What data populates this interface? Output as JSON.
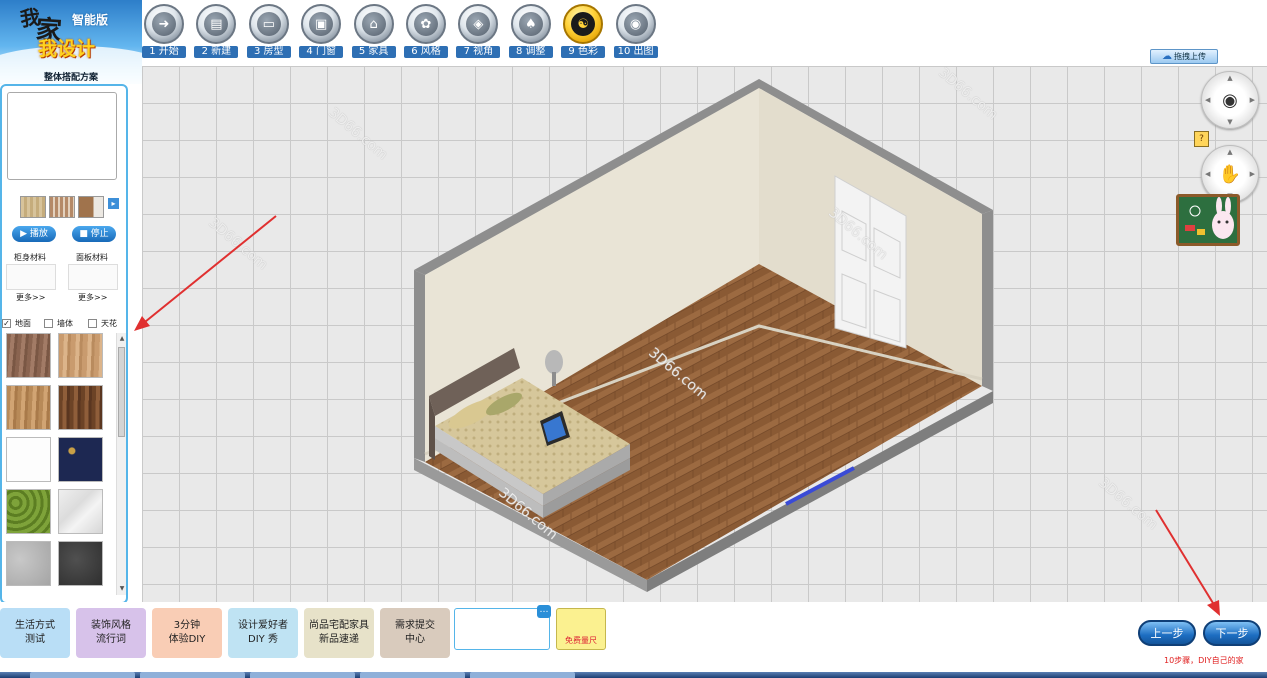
{
  "logo": {
    "line1": "我",
    "line2": "家",
    "subtitle": "我设计",
    "version": "智能版"
  },
  "sidebar": {
    "title": "整体搭配方案",
    "play_label": "▶ 播放",
    "stop_label": "■ 停止",
    "cabinet_label": "柜身材料",
    "panel_label": "面板材料",
    "more_left": "更多>>",
    "more_right": "更多>>",
    "surface_tabs": [
      {
        "label": "地面",
        "checked": true
      },
      {
        "label": "墙体",
        "checked": false
      },
      {
        "label": "天花",
        "checked": false
      }
    ]
  },
  "steps": [
    {
      "label": "1 开始",
      "icon": "arrow-right-icon",
      "glyph": "➜"
    },
    {
      "label": "2 新建",
      "icon": "new-file-icon",
      "glyph": "▤"
    },
    {
      "label": "3 房型",
      "icon": "floorplan-icon",
      "glyph": "▭"
    },
    {
      "label": "4 门窗",
      "icon": "window-icon",
      "glyph": "▣"
    },
    {
      "label": "5 家具",
      "icon": "furniture-icon",
      "glyph": "⌂"
    },
    {
      "label": "6 风格",
      "icon": "style-icon",
      "glyph": "✿"
    },
    {
      "label": "7 视角",
      "icon": "cube-icon",
      "glyph": "◈"
    },
    {
      "label": "8 调整",
      "icon": "lamp-icon",
      "glyph": "♠"
    },
    {
      "label": "9 色彩",
      "icon": "palette-icon",
      "glyph": "☯",
      "active": true
    },
    {
      "label": "10 出图",
      "icon": "camera-icon",
      "glyph": "◉"
    }
  ],
  "toolbar": {
    "upload_label": "拖拽上传"
  },
  "watermark": "3D66.com",
  "bottom": {
    "buttons": [
      {
        "label": "生活方式\n测试",
        "color": "#b9def6"
      },
      {
        "label": "装饰风格\n流行词",
        "color": "#d7c2ea"
      },
      {
        "label": "3分钟\n体验DIY",
        "color": "#f9cdb5"
      },
      {
        "label": "设计爱好者\nDIY 秀",
        "color": "#bfe3f3"
      },
      {
        "label": "尚品宅配家具\n新品速递",
        "color": "#e7e2c9"
      },
      {
        "label": "需求提交\n中心",
        "color": "#d9cbbd"
      }
    ],
    "measure_label": "免费量尺",
    "prev_label": "上一步",
    "next_label": "下一步",
    "hint": "10步骤，DIY自己的家"
  },
  "colors": {
    "accent": "#55b5e9",
    "floor": "#8a5a34",
    "wall": "#ebe6d8",
    "active_step": "#ffd23a",
    "annotation": "#e03030"
  }
}
